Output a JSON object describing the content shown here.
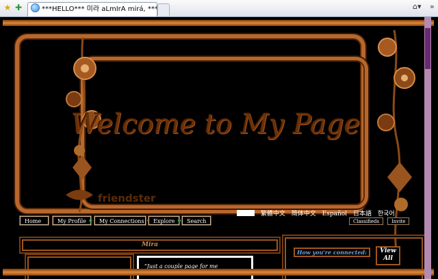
{
  "browser": {
    "tab_title": "***HELLO*** 미라 aLmIrA mirá, ***Welcome...",
    "home_icon": "home-icon",
    "overflow": "»"
  },
  "banner": {
    "headline": "Welcome to My Page",
    "brand": "friendster"
  },
  "languages": [
    "繁體中文",
    "简体中文",
    "Español",
    "日本語",
    "한국어"
  ],
  "nav": {
    "home": "Home",
    "my_profile": "My Profile",
    "my_connections": "My Connections",
    "explore": "Explore",
    "search": "Search",
    "classifieds": "Classifieds",
    "invite": "Invite"
  },
  "profile": {
    "name": "Mira",
    "blurb": "\"Just a couple page for me"
  },
  "connections": {
    "title": "How you're connected:",
    "view_all_line1": "View",
    "view_all_line2": "All"
  },
  "colors": {
    "copper": "#b8672c",
    "dark_copper": "#6a3008",
    "nav_arrow": "#3cb54a"
  }
}
